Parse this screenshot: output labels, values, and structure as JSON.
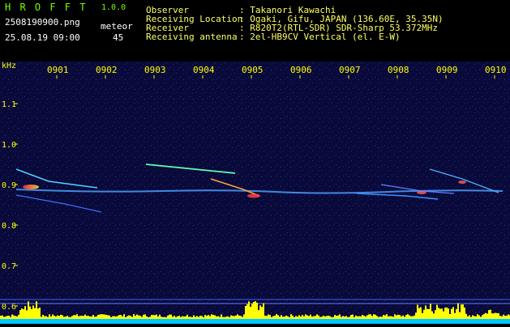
{
  "header": {
    "app_title": "H R O F F T",
    "app_version": "1.0.0",
    "filename": "2508190900.png",
    "datetime": "25.08.19 09:00",
    "meteor_label": "meteor",
    "meteor_count": "45",
    "fields": [
      {
        "label": "Observer",
        "value": ": Takanori Kawachi"
      },
      {
        "label": "Receiving Location",
        "value": ": Ogaki, Gifu, JAPAN (136.60E, 35.35N)"
      },
      {
        "label": "Receiver",
        "value": ": R820T2(RTL-SDR) SDR-Sharp 53.372MHz"
      },
      {
        "label": "Receiving antenna",
        "value": ": 2el-HB9CV Vertical (el. E-W)"
      }
    ]
  },
  "spectrogram": {
    "freq_unit": "kHz",
    "freq_ticks": [
      "1.1",
      "1.0",
      "0.9",
      "0.8",
      "0.7",
      "0.6"
    ],
    "time_ticks": [
      "0901",
      "0902",
      "0903",
      "0904",
      "0905",
      "0906",
      "0907",
      "0908",
      "0909",
      "0910"
    ],
    "colors": {
      "background": "#0a0a3a",
      "tick": "#FFFF00",
      "trace_hot": "#FF4040",
      "trace_cold": "#40C0FF",
      "bottom": "#FFFF00"
    }
  }
}
